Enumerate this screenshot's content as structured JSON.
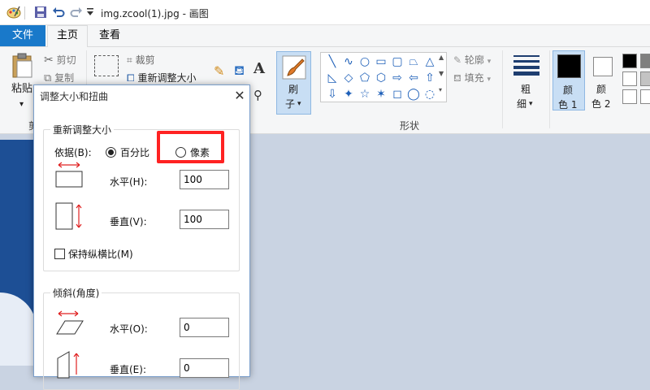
{
  "window": {
    "title": "img.zcool(1).jpg - 画图"
  },
  "tabs": {
    "file": "文件",
    "home": "主页",
    "view": "查看"
  },
  "clipboard": {
    "paste": "粘贴",
    "paste_arrow": "▾",
    "cut": "剪切",
    "copy": "复制",
    "group_partial": "剪"
  },
  "image_group": {
    "crop": "裁剪",
    "resize": "重新调整大小"
  },
  "brush": {
    "label_line1": "刷",
    "label_line2": "子",
    "arrow": "▾"
  },
  "shapes": {
    "outline": "轮廓",
    "fill": "填充",
    "group_label": "形状",
    "row1": [
      "╲",
      "∿",
      "○",
      "▭",
      "▢",
      "⏢",
      "△"
    ],
    "row2": [
      "◺",
      "◇",
      "⬠",
      "⬡",
      "⇨",
      "⇦",
      "⇧"
    ],
    "row3": [
      "⇩",
      "✦",
      "☆",
      "✶",
      "◻",
      "◯",
      "◌"
    ]
  },
  "size": {
    "line1": "粗",
    "line2": "细",
    "arrow": "▾"
  },
  "colors": {
    "color1_line1": "颜",
    "color1_line2": "色 1",
    "color2_line1": "颜",
    "color2_line2": "色 2",
    "color1_value": "#000000",
    "color2_value": "#ffffff",
    "palette": [
      "#000000",
      "#7f7f7f",
      "#ffffff",
      "#c3c3c3",
      "#ffffff",
      "#ffffff"
    ]
  },
  "dialog": {
    "title": "调整大小和扭曲",
    "close": "✕",
    "resize_section": "重新调整大小",
    "by_label": "依据(B):",
    "percent_option": "百分比",
    "pixels_option": "像素",
    "selected_option": "percent",
    "horizontal_label": "水平(H):",
    "horizontal_value": "100",
    "vertical_label": "垂直(V):",
    "vertical_value": "100",
    "keep_ratio_label": "保持纵横比(M)",
    "keep_ratio_checked": false,
    "skew_section": "倾斜(角度)",
    "skew_horizontal_label": "水平(O):",
    "skew_horizontal_value": "0",
    "skew_vertical_label": "垂直(E):",
    "skew_vertical_value": "0"
  },
  "accent": {
    "ribbon_blue": "#1979ca",
    "highlight_red": "#ff2222"
  }
}
